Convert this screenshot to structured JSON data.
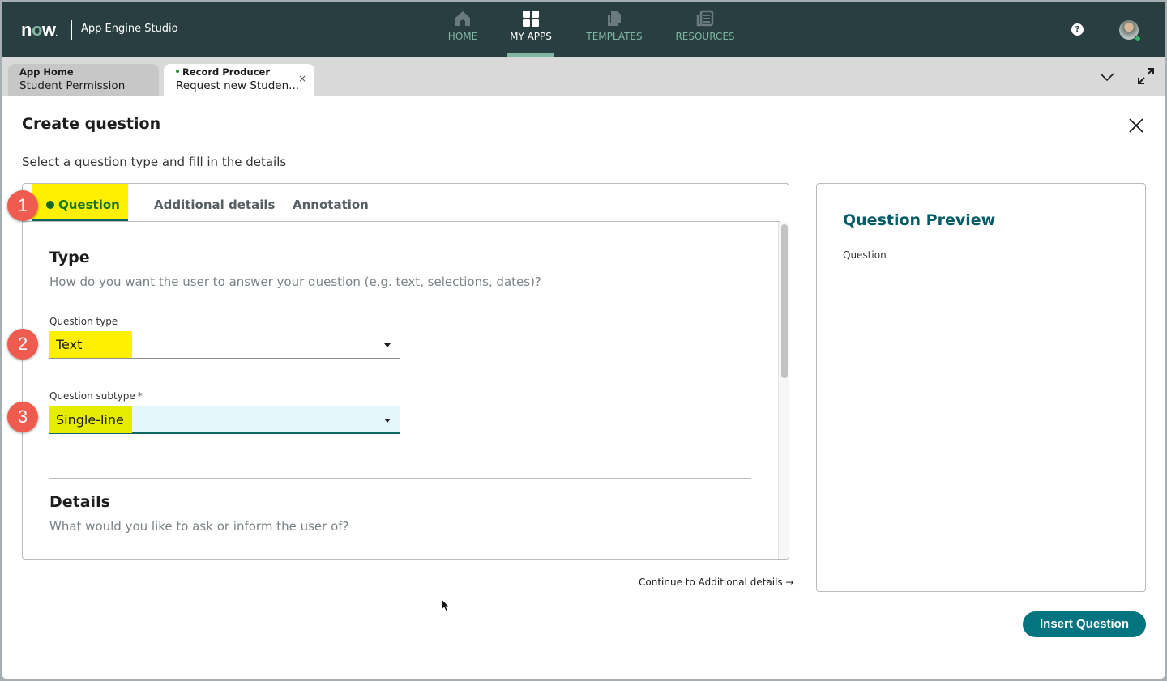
{
  "header": {
    "logo": "now",
    "app_name": "App Engine Studio",
    "nav": [
      {
        "label": "HOME",
        "icon": "home-icon",
        "active": false
      },
      {
        "label": "MY APPS",
        "icon": "grid-icon",
        "active": true
      },
      {
        "label": "TEMPLATES",
        "icon": "documents-icon",
        "active": false
      },
      {
        "label": "RESOURCES",
        "icon": "newspaper-icon",
        "active": false
      }
    ],
    "help_glyph": "?",
    "accent_color": "#81b5a1",
    "background_color": "#293e41"
  },
  "tabs": [
    {
      "line1": "App Home",
      "line2": "Student Permission",
      "active": false
    },
    {
      "line1": "Record Producer",
      "line2": "Request new Studen...",
      "active": true,
      "close_glyph": "×"
    }
  ],
  "modal": {
    "title": "Create question",
    "subtitle": "Select a question type and fill in the details",
    "tabs": [
      {
        "label": "Question",
        "active": true
      },
      {
        "label": "Additional details",
        "active": false
      },
      {
        "label": "Annotation",
        "active": false
      }
    ],
    "type_section": {
      "title": "Type",
      "description": "How do you want the user to answer your question (e.g. text, selections, dates)?"
    },
    "question_type": {
      "label": "Question type",
      "value": "Text"
    },
    "question_subtype": {
      "label": "Question subtype",
      "required_mark": "*",
      "value": "Single-line"
    },
    "details_section": {
      "title": "Details",
      "description": "What would you like to ask or inform the user of?"
    },
    "continue_link": "Continue to Additional details →",
    "preview": {
      "title": "Question Preview",
      "question_label": "Question",
      "question_value": ""
    },
    "insert_button": "Insert Question",
    "primary_color": "#047480"
  },
  "annotations": {
    "badges": [
      "1",
      "2",
      "3"
    ],
    "badge_color": "#ef5b4e",
    "highlight_color": "#ffef00"
  }
}
